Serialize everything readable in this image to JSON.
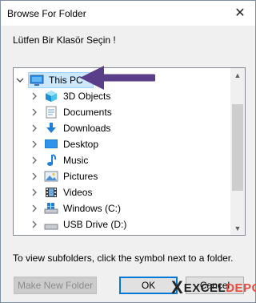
{
  "window": {
    "title": "Browse For Folder",
    "close_glyph": "✕"
  },
  "dialog": {
    "instruction": "Lütfen Bir Klasör Seçin !",
    "hint": "To view subfolders, click the symbol next to a folder."
  },
  "tree": {
    "root": {
      "label": "This PC",
      "icon": "computer-icon",
      "expanded": true,
      "selected": true
    },
    "children": [
      {
        "label": "3D Objects",
        "icon": "3d-objects-icon"
      },
      {
        "label": "Documents",
        "icon": "documents-icon"
      },
      {
        "label": "Downloads",
        "icon": "downloads-icon"
      },
      {
        "label": "Desktop",
        "icon": "desktop-icon"
      },
      {
        "label": "Music",
        "icon": "music-icon"
      },
      {
        "label": "Pictures",
        "icon": "pictures-icon"
      },
      {
        "label": "Videos",
        "icon": "videos-icon"
      },
      {
        "label": "Windows (C:)",
        "icon": "drive-icon"
      },
      {
        "label": "USB Drive (D:)",
        "icon": "usb-drive-icon"
      }
    ]
  },
  "buttons": {
    "new_folder": "Make New Folder",
    "ok": "OK",
    "cancel": "Cancel"
  },
  "watermark": {
    "x": "X",
    "part1": "EXCEL",
    "part2": "DEPO"
  },
  "colors": {
    "selection": "#cce8ff",
    "accent": "#0078d7",
    "annotation_arrow": "#5a3e8a"
  }
}
